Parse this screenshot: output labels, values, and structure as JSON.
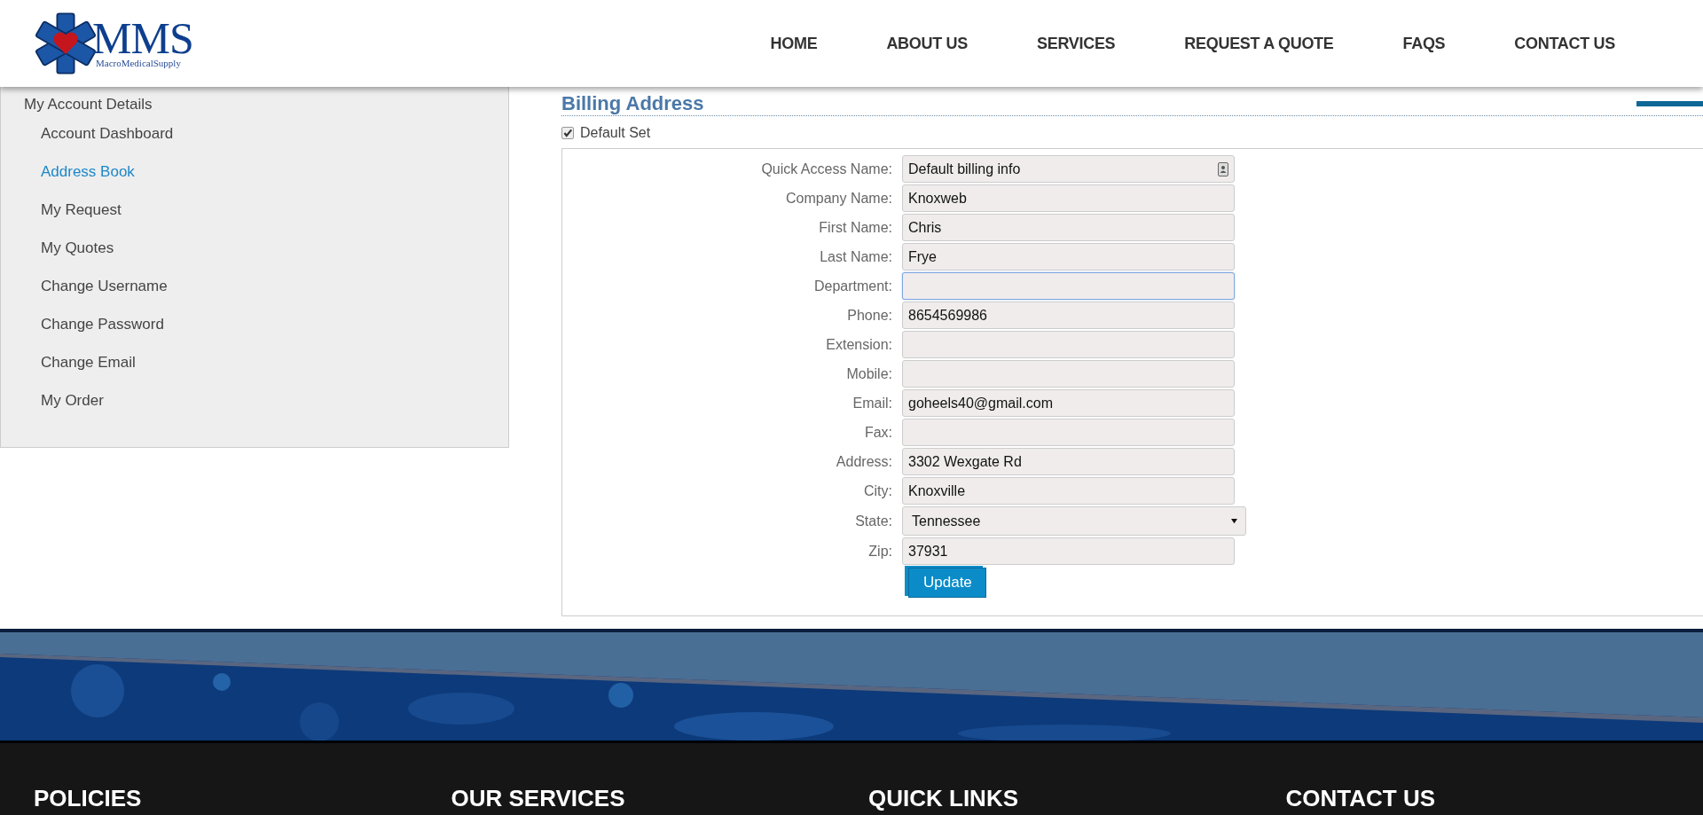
{
  "header": {
    "logo": {
      "mark": "MMS",
      "tagline": "MacroMedicalSupply"
    },
    "nav": [
      {
        "label": "HOME",
        "selected": false
      },
      {
        "label": "ABOUT US",
        "selected": false
      },
      {
        "label": "SERVICES",
        "selected": false
      },
      {
        "label": "REQUEST A QUOTE",
        "selected": false
      },
      {
        "label": "FAQS",
        "selected": false
      },
      {
        "label": "CONTACT US",
        "selected": false
      }
    ]
  },
  "sidebar": {
    "title": "My Account Details",
    "items": [
      {
        "label": "Account Dashboard",
        "selected": false
      },
      {
        "label": "Address Book",
        "selected": true
      },
      {
        "label": "My Request",
        "selected": false
      },
      {
        "label": "My Quotes",
        "selected": false
      },
      {
        "label": "Change Username",
        "selected": false
      },
      {
        "label": "Change Password",
        "selected": false
      },
      {
        "label": "Change Email",
        "selected": false
      },
      {
        "label": "My Order",
        "selected": false
      }
    ]
  },
  "form": {
    "title": "Billing Address",
    "default_set": {
      "label": "Default Set",
      "checked": true
    },
    "fields": [
      {
        "label": "Quick Access Name:",
        "kind": "text",
        "value": "Default billing info",
        "has_contact_icon": true,
        "focused": false
      },
      {
        "label": "Company Name:",
        "kind": "text",
        "value": "Knoxweb",
        "focused": false
      },
      {
        "label": "First Name:",
        "kind": "text",
        "value": "Chris",
        "focused": false
      },
      {
        "label": "Last Name:",
        "kind": "text",
        "value": "Frye",
        "focused": false
      },
      {
        "label": "Department:",
        "kind": "text",
        "focused": true
      },
      {
        "label": "Phone:",
        "kind": "text",
        "value": "8654569986",
        "focused": false
      },
      {
        "label": "Extension:",
        "kind": "text",
        "focused": false
      },
      {
        "label": "Mobile:",
        "kind": "text",
        "focused": false
      },
      {
        "label": "Email:",
        "kind": "text",
        "value": "goheels40@gmail.com",
        "focused": false
      },
      {
        "label": "Fax:",
        "kind": "text",
        "focused": false
      },
      {
        "label": "Address:",
        "kind": "text",
        "value": "3302 Wexgate Rd",
        "focused": false
      },
      {
        "label": "City:",
        "kind": "text",
        "value": "Knoxville",
        "focused": false
      },
      {
        "label": "State:",
        "kind": "select",
        "value": "Tennessee",
        "focused": false
      },
      {
        "label": "Zip:",
        "kind": "text",
        "value": "37931",
        "focused": false
      }
    ],
    "submit": "Update"
  },
  "footer": {
    "headings": [
      "POLICIES",
      "OUR SERVICES",
      "QUICK LINKS",
      "CONTACT US"
    ]
  }
}
